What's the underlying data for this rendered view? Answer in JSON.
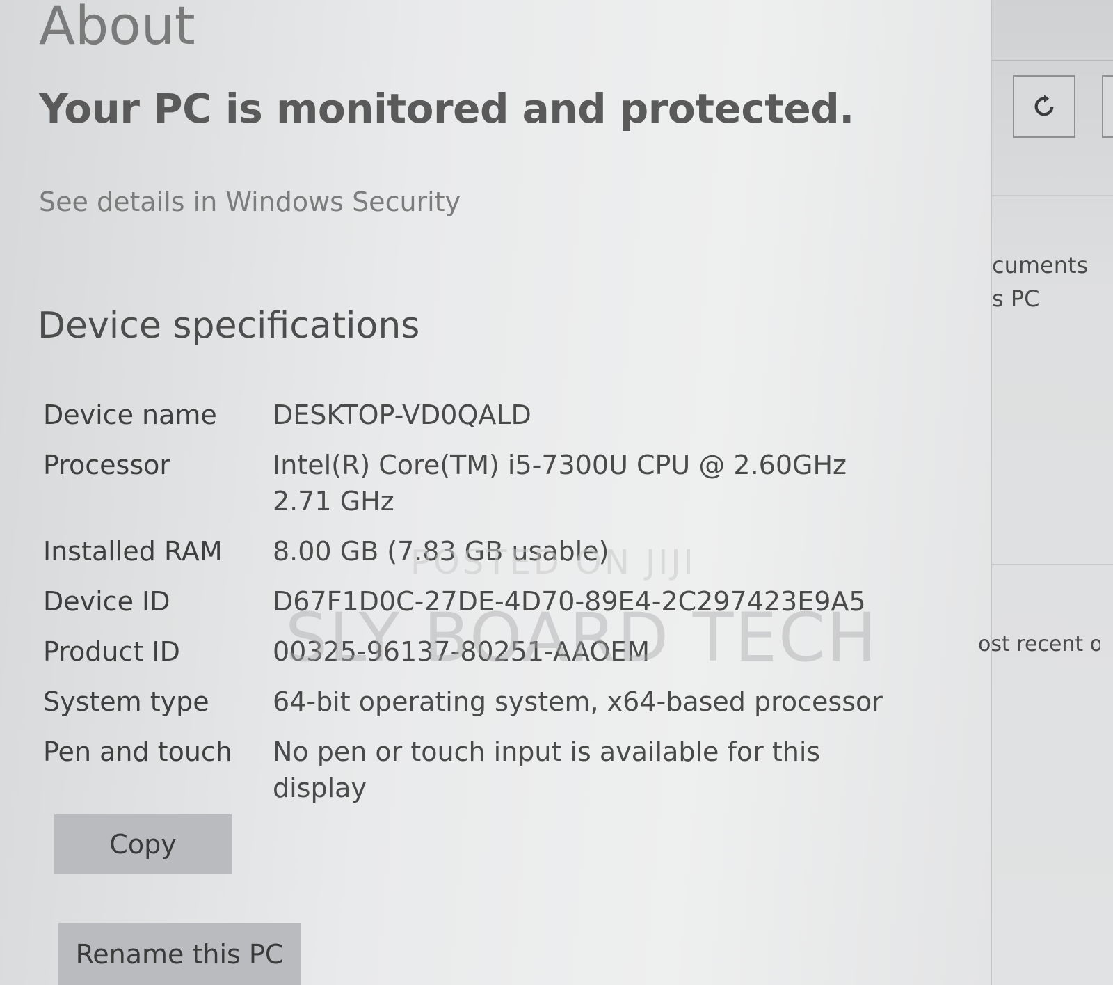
{
  "page": {
    "title": "About",
    "protection_status": "Your PC is monitored and protected.",
    "security_link": "See details in Windows Security"
  },
  "device_specifications": {
    "title": "Device specifications",
    "rows": [
      {
        "label": "Device name",
        "value": "DESKTOP-VD0QALD"
      },
      {
        "label": "Processor",
        "value": "Intel(R) Core(TM) i5-7300U CPU @ 2.60GHz   2.71 GHz"
      },
      {
        "label": "Installed RAM",
        "value": "8.00 GB (7.83 GB usable)"
      },
      {
        "label": "Device ID",
        "value": "D67F1D0C-27DE-4D70-89E4-2C297423E9A5"
      },
      {
        "label": "Product ID",
        "value": "00325-96137-80251-AAOEM"
      },
      {
        "label": "System type",
        "value": "64-bit operating system, x64-based processor"
      },
      {
        "label": "Pen and touch",
        "value": "No pen or touch input is available for this display"
      }
    ],
    "copy_button": "Copy",
    "rename_button": "Rename this PC"
  },
  "side_panel": {
    "text_1": "cuments",
    "text_2": "s PC",
    "text_3": "ost recent or"
  },
  "watermarks": {
    "small": "POSTED ON JIJI",
    "large": "SLY BOARD TECH"
  }
}
